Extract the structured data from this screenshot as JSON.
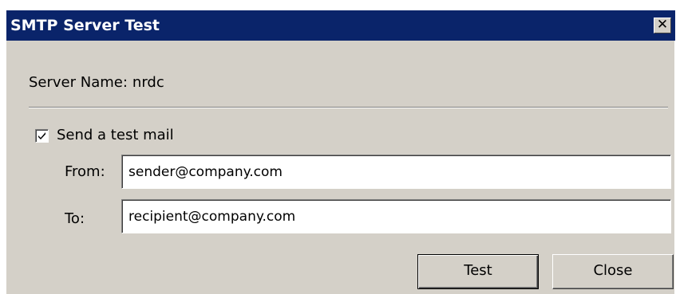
{
  "window": {
    "title": "SMTP Server Test",
    "close_glyph": "✕"
  },
  "server": {
    "label": "Server Name:",
    "value": "nrdc"
  },
  "send_test": {
    "label": "Send a test mail",
    "checked": true
  },
  "from": {
    "label": "From:",
    "value": "sender@company.com"
  },
  "to": {
    "label": "To:",
    "value": "recipient@company.com"
  },
  "buttons": {
    "test_label": "Test",
    "close_label": "Close"
  },
  "colors": {
    "titlebar": "#0a246a",
    "dialog_face": "#d4d0c8"
  },
  "icons": {
    "close": "close-icon",
    "check": "checkmark-icon"
  }
}
